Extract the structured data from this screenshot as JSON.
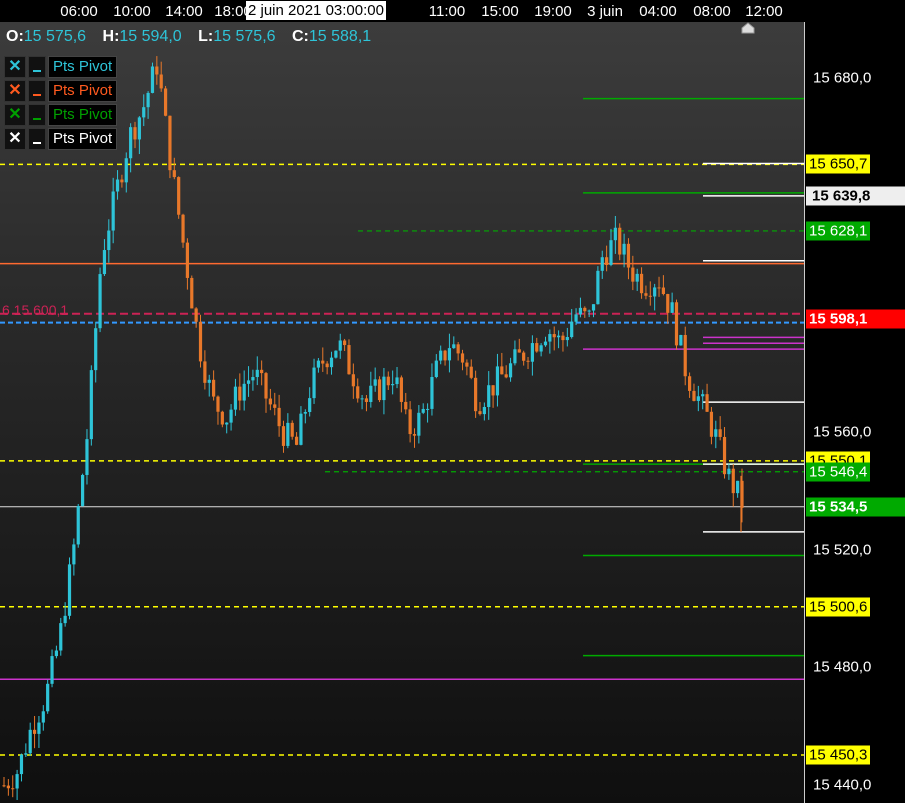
{
  "top_axis": {
    "labels": [
      "06:00",
      "10:00",
      "14:00",
      "18:00",
      "2 juin 2021 03:00:00",
      "11:00",
      "15:00",
      "19:00",
      "3 juin",
      "04:00",
      "08:00",
      "12:00"
    ],
    "cursor_label": "2 juin 2021 03:00:00"
  },
  "ohlc": {
    "o_key": "O:",
    "o": "15 575,6",
    "h_key": "H:",
    "h": "15 594,0",
    "l_key": "L:",
    "l": "15 575,6",
    "c_key": "C:",
    "c": "15 588,1"
  },
  "legend": [
    {
      "mark": "✕",
      "label": "Pts Pivot",
      "color": "#2ec4d8"
    },
    {
      "mark": "✕",
      "label": "Pts Pivot",
      "color": "#ff5a1f"
    },
    {
      "mark": "✕",
      "label": "Pts Pivot",
      "color": "#00a000"
    },
    {
      "mark": "✕",
      "label": "Pts Pivot",
      "color": "#ffffff"
    }
  ],
  "overlay_text": "6 15 600,1",
  "price_axis": {
    "labels": [
      "15 680,0",
      "15 560,0",
      "15 520,0",
      "15 480,0",
      "15 440,0"
    ],
    "range": [
      15434,
      15699
    ]
  },
  "tags": [
    {
      "text": "15 650,7",
      "bg": "#ffff00",
      "fg": "#000000"
    },
    {
      "text": "15 639,8",
      "bg": "#eeeeee",
      "fg": "#000000"
    },
    {
      "text": "15 628,1",
      "bg": "#00aa00",
      "fg": "#ffffff"
    },
    {
      "text": "15 598,1",
      "bg": "#ff0000",
      "fg": "#ffffff"
    },
    {
      "text": "15 550,1",
      "bg": "#ffff00",
      "fg": "#000000"
    },
    {
      "text": "15 546,4",
      "bg": "#00aa00",
      "fg": "#ffffff"
    },
    {
      "text": "15 534,5",
      "bg": "#00aa00",
      "fg": "#ffffff"
    },
    {
      "text": "15 500,6",
      "bg": "#ffff00",
      "fg": "#000000"
    },
    {
      "text": "15 450,3",
      "bg": "#ffff00",
      "fg": "#000000"
    }
  ],
  "colors": {
    "up": "#2ec4d8",
    "down": "#e8782a",
    "pivot_yellow": "#ffff00",
    "green": "#00aa00",
    "magenta": "#cc33cc",
    "orange": "#ff6a30",
    "white": "#ffffff"
  },
  "chart_data": {
    "type": "line",
    "price_levels": [
      15680.0,
      15560.0,
      15520.0,
      15480.0,
      15440.0
    ],
    "pivot_levels": [
      15650.7,
      15550.1,
      15500.6,
      15450.3
    ],
    "green_levels": [
      15628.1,
      15546.4
    ],
    "last_price": 15534.5,
    "marked_prices": [
      15639.8,
      15598.1
    ],
    "close_path": [
      15440,
      15445,
      15460,
      15470,
      15490,
      15520,
      15560,
      15620,
      15640,
      15660,
      15670,
      15685,
      15650,
      15620,
      15590,
      15570,
      15565,
      15575,
      15580,
      15570,
      15560,
      15555,
      15575,
      15585,
      15590,
      15580,
      15570,
      15575,
      15580,
      15560,
      15565,
      15580,
      15590,
      15585,
      15570,
      15575,
      15580,
      15585,
      15590,
      15595,
      15590,
      15600,
      15598,
      15620,
      15625,
      15615,
      15610,
      15612,
      15600,
      15580,
      15570,
      15560,
      15545,
      15536
    ]
  }
}
